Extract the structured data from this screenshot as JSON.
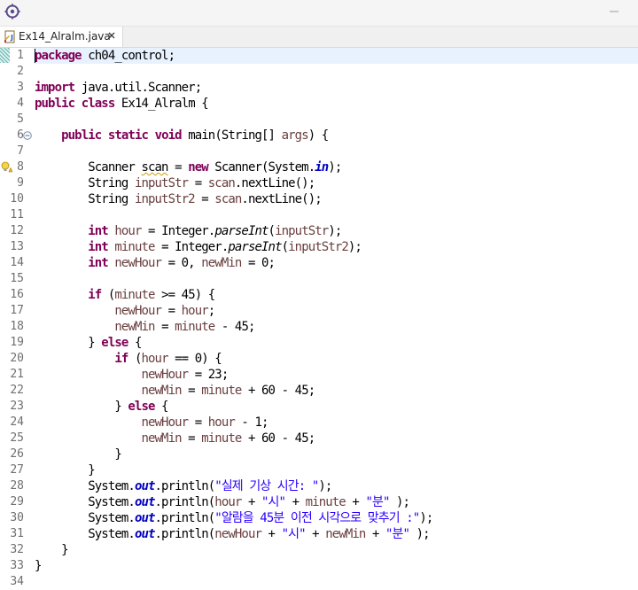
{
  "tab": {
    "file_name": "Ex14_Alralm.java"
  },
  "code_lines": [
    [
      [
        "kw",
        "package"
      ],
      [
        "t",
        " ch04_control;"
      ]
    ],
    [],
    [
      [
        "kw",
        "import"
      ],
      [
        "t",
        " java.util.Scanner;"
      ]
    ],
    [
      [
        "kw",
        "public"
      ],
      [
        "t",
        " "
      ],
      [
        "kw",
        "class"
      ],
      [
        "t",
        " Ex14_Alralm {"
      ]
    ],
    [],
    [
      [
        "t",
        "    "
      ],
      [
        "kw",
        "public"
      ],
      [
        "t",
        " "
      ],
      [
        "kw",
        "static"
      ],
      [
        "t",
        " "
      ],
      [
        "kw",
        "void"
      ],
      [
        "t",
        " main(String[] "
      ],
      [
        "var",
        "args"
      ],
      [
        "t",
        ") {"
      ]
    ],
    [],
    [
      [
        "t",
        "        Scanner "
      ],
      [
        "warn",
        "scan"
      ],
      [
        "t",
        " = "
      ],
      [
        "kw",
        "new"
      ],
      [
        "t",
        " Scanner(System."
      ],
      [
        "fld",
        "in"
      ],
      [
        "t",
        ");"
      ]
    ],
    [
      [
        "t",
        "        String "
      ],
      [
        "var",
        "inputStr"
      ],
      [
        "t",
        " = "
      ],
      [
        "var",
        "scan"
      ],
      [
        "t",
        ".nextLine();"
      ]
    ],
    [
      [
        "t",
        "        String "
      ],
      [
        "var",
        "inputStr2"
      ],
      [
        "t",
        " = "
      ],
      [
        "var",
        "scan"
      ],
      [
        "t",
        ".nextLine();"
      ]
    ],
    [],
    [
      [
        "t",
        "        "
      ],
      [
        "kw",
        "int"
      ],
      [
        "t",
        " "
      ],
      [
        "var",
        "hour"
      ],
      [
        "t",
        " = Integer."
      ],
      [
        "stm",
        "parseInt"
      ],
      [
        "t",
        "("
      ],
      [
        "var",
        "inputStr"
      ],
      [
        "t",
        ");"
      ]
    ],
    [
      [
        "t",
        "        "
      ],
      [
        "kw",
        "int"
      ],
      [
        "t",
        " "
      ],
      [
        "var",
        "minute"
      ],
      [
        "t",
        " = Integer."
      ],
      [
        "stm",
        "parseInt"
      ],
      [
        "t",
        "("
      ],
      [
        "var",
        "inputStr2"
      ],
      [
        "t",
        ");"
      ]
    ],
    [
      [
        "t",
        "        "
      ],
      [
        "kw",
        "int"
      ],
      [
        "t",
        " "
      ],
      [
        "var",
        "newHour"
      ],
      [
        "t",
        " = 0, "
      ],
      [
        "var",
        "newMin"
      ],
      [
        "t",
        " = 0;"
      ]
    ],
    [],
    [
      [
        "t",
        "        "
      ],
      [
        "kw",
        "if"
      ],
      [
        "t",
        " ("
      ],
      [
        "var",
        "minute"
      ],
      [
        "t",
        " >= 45) {"
      ]
    ],
    [
      [
        "t",
        "            "
      ],
      [
        "var",
        "newHour"
      ],
      [
        "t",
        " = "
      ],
      [
        "var",
        "hour"
      ],
      [
        "t",
        ";"
      ]
    ],
    [
      [
        "t",
        "            "
      ],
      [
        "var",
        "newMin"
      ],
      [
        "t",
        " = "
      ],
      [
        "var",
        "minute"
      ],
      [
        "t",
        " - 45;"
      ]
    ],
    [
      [
        "t",
        "        } "
      ],
      [
        "kw",
        "else"
      ],
      [
        "t",
        " {"
      ]
    ],
    [
      [
        "t",
        "            "
      ],
      [
        "kw",
        "if"
      ],
      [
        "t",
        " ("
      ],
      [
        "var",
        "hour"
      ],
      [
        "t",
        " == 0) {"
      ]
    ],
    [
      [
        "t",
        "                "
      ],
      [
        "var",
        "newHour"
      ],
      [
        "t",
        " = 23;"
      ]
    ],
    [
      [
        "t",
        "                "
      ],
      [
        "var",
        "newMin"
      ],
      [
        "t",
        " = "
      ],
      [
        "var",
        "minute"
      ],
      [
        "t",
        " + 60 - 45;"
      ]
    ],
    [
      [
        "t",
        "            } "
      ],
      [
        "kw",
        "else"
      ],
      [
        "t",
        " {"
      ]
    ],
    [
      [
        "t",
        "                "
      ],
      [
        "var",
        "newHour"
      ],
      [
        "t",
        " = "
      ],
      [
        "var",
        "hour"
      ],
      [
        "t",
        " - 1;"
      ]
    ],
    [
      [
        "t",
        "                "
      ],
      [
        "var",
        "newMin"
      ],
      [
        "t",
        " = "
      ],
      [
        "var",
        "minute"
      ],
      [
        "t",
        " + 60 - 45;"
      ]
    ],
    [
      [
        "t",
        "            }"
      ]
    ],
    [
      [
        "t",
        "        }"
      ]
    ],
    [
      [
        "t",
        "        System."
      ],
      [
        "fld",
        "out"
      ],
      [
        "t",
        ".println("
      ],
      [
        "str",
        "\"실제 기상 시간: \""
      ],
      [
        "t",
        ");"
      ]
    ],
    [
      [
        "t",
        "        System."
      ],
      [
        "fld",
        "out"
      ],
      [
        "t",
        ".println("
      ],
      [
        "var",
        "hour"
      ],
      [
        "t",
        " + "
      ],
      [
        "str",
        "\"시\""
      ],
      [
        "t",
        " + "
      ],
      [
        "var",
        "minute"
      ],
      [
        "t",
        " + "
      ],
      [
        "str",
        "\"분\""
      ],
      [
        "t",
        " );"
      ]
    ],
    [
      [
        "t",
        "        System."
      ],
      [
        "fld",
        "out"
      ],
      [
        "t",
        ".println("
      ],
      [
        "str",
        "\"알람을 45분 이전 시각으로 맞추기 :\""
      ],
      [
        "t",
        ");"
      ]
    ],
    [
      [
        "t",
        "        System."
      ],
      [
        "fld",
        "out"
      ],
      [
        "t",
        ".println("
      ],
      [
        "var",
        "newHour"
      ],
      [
        "t",
        " + "
      ],
      [
        "str",
        "\"시\""
      ],
      [
        "t",
        " + "
      ],
      [
        "var",
        "newMin"
      ],
      [
        "t",
        " + "
      ],
      [
        "str",
        "\"분\""
      ],
      [
        "t",
        " );"
      ]
    ],
    [
      [
        "t",
        "    }"
      ]
    ],
    [
      [
        "t",
        "}"
      ]
    ],
    []
  ],
  "line_numbers": [
    "1",
    "2",
    "3",
    "4",
    "5",
    "6",
    "7",
    "8",
    "9",
    "10",
    "11",
    "12",
    "13",
    "14",
    "15",
    "16",
    "17",
    "18",
    "19",
    "20",
    "21",
    "22",
    "23",
    "24",
    "25",
    "26",
    "27",
    "28",
    "29",
    "30",
    "31",
    "32",
    "33",
    "34"
  ],
  "gutter": {
    "fold_line": "6",
    "warning_line": "8",
    "current_line": "1"
  },
  "colors": {
    "keyword": "#7f0055",
    "local_variable": "#6a3e3e",
    "static_field": "#0000c0",
    "string": "#2a00ff",
    "current_line_bg": "#e8f2fe"
  },
  "icons": [
    "perspective-icon",
    "java-file-icon",
    "close-icon",
    "fold-minus-icon",
    "warning-lightbulb-icon"
  ]
}
